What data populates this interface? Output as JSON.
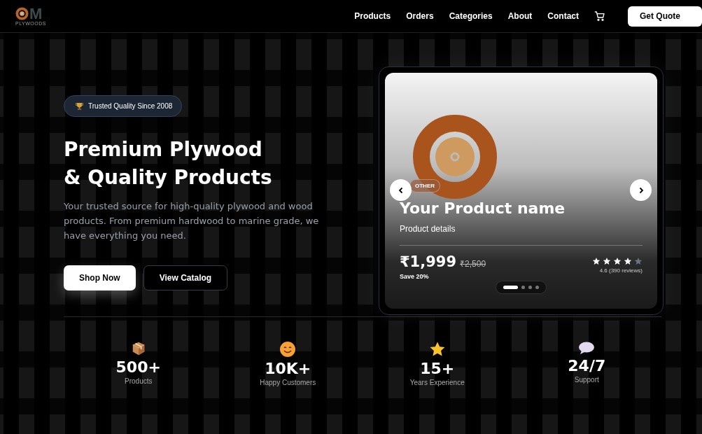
{
  "logo": {
    "letter": "M",
    "subtitle": "PLYWOODS"
  },
  "nav": {
    "links": [
      "Products",
      "Orders",
      "Categories",
      "About",
      "Contact"
    ],
    "cta": "Get Quote"
  },
  "hero": {
    "badge": "Trusted Quality Since 2008",
    "title_lines": [
      "Premium Plywood",
      "& Quality Products"
    ],
    "description": "Your trusted source for high-quality plywood and wood products. From premium hardwood to marine grade, we have everything you need.",
    "buttons": [
      {
        "label": "Shop Now",
        "kind": "primary"
      },
      {
        "label": "View Catalog",
        "kind": "outline"
      }
    ]
  },
  "product_card": {
    "tag": "OTHER",
    "name": "Your Product name",
    "details": "Product details",
    "price": "₹1,999",
    "old_price": "₹2,500",
    "saving": "Save 20%",
    "stars": 4,
    "rating": "4.6 (390 reviews)",
    "carousel_dots": [
      {
        "selected": true
      },
      {
        "selected": false
      },
      {
        "selected": false
      },
      {
        "selected": false
      }
    ]
  },
  "stats": [
    {
      "kind": "box",
      "value": "500+",
      "label": "Products"
    },
    {
      "kind": "smile",
      "value": "10K+",
      "label": "Happy Customers"
    },
    {
      "kind": "star",
      "value": "15+",
      "label": "Years Experience"
    },
    {
      "kind": "bubble",
      "value": "24/7",
      "label": "Support"
    }
  ]
}
